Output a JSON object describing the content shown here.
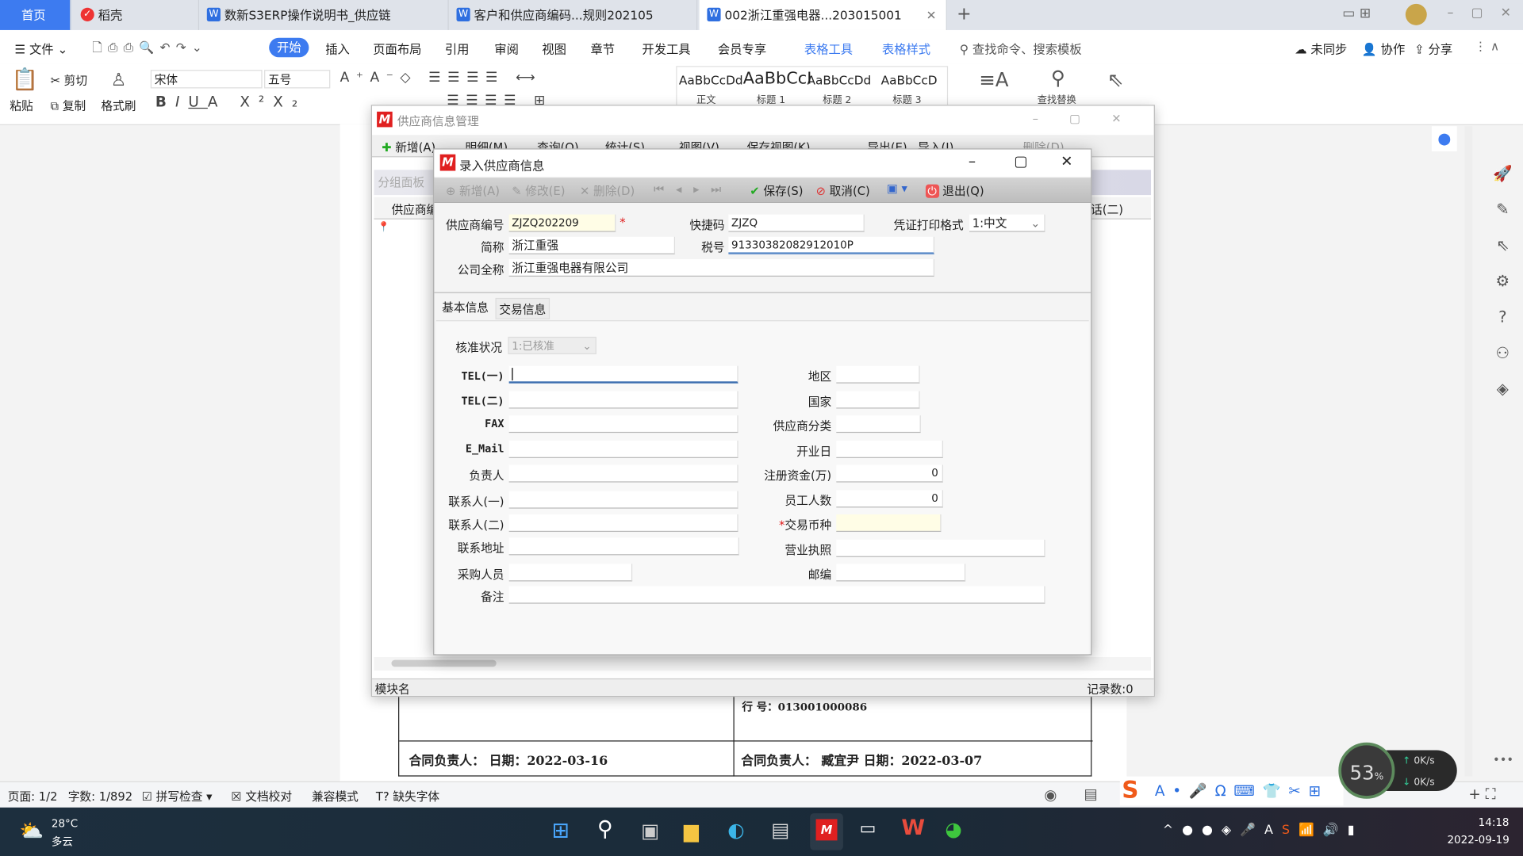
{
  "tabs": [
    {
      "label": "首页"
    },
    {
      "label": "稻壳"
    },
    {
      "label": "数新S3ERP操作说明书_供应链"
    },
    {
      "label": "客户和供应商编码...规则202105"
    },
    {
      "label": "002浙江重强电器...203015001"
    }
  ],
  "menu": {
    "file": "文件",
    "items": [
      "开始",
      "插入",
      "页面布局",
      "引用",
      "审阅",
      "视图",
      "章节",
      "开发工具",
      "会员专享",
      "表格工具",
      "表格样式"
    ],
    "search": "查找命令、搜索模板",
    "sync": "未同步",
    "collab": "协作",
    "share": "分享"
  },
  "ribbon": {
    "paste": "粘贴",
    "cut": "剪切",
    "copy": "复制",
    "format_painter": "格式刷",
    "font": "宋体",
    "size": "五号",
    "styles": [
      {
        "sample": "AaBbCcDd",
        "name": "正文"
      },
      {
        "sample": "AaBbCcI",
        "name": "标题 1"
      },
      {
        "sample": "AaBbCcDd",
        "name": "标题 2"
      },
      {
        "sample": "AaBbCcD",
        "name": "标题 3"
      }
    ],
    "layout": "文字排版",
    "find": "查找替换",
    "select": "选择"
  },
  "document": {
    "cell1": "合同负责人：    日期：2022-03-16",
    "cell2": "合同负责人：  臧宜尹   日期：2022-03-07",
    "partial": "行  号：013001000086"
  },
  "outer_window": {
    "title": "供应商信息管理",
    "toolbar": [
      "新增(A)",
      "明细(M)",
      "查询(Q)",
      "统计(S)",
      "视图(V)",
      "保存视图(K)",
      "导出(E)",
      "导入(I)",
      "删除(D)"
    ],
    "group_panel": "分组面板",
    "col_first": "供应商编",
    "col_last": "话(二)",
    "module": "模块名",
    "records": "记录数:0"
  },
  "dialog": {
    "title": "录入供应商信息",
    "toolbar": {
      "new": "新增(A)",
      "edit": "修改(E)",
      "delete": "删除(D)",
      "save": "保存(S)",
      "cancel": "取消(C)",
      "exit": "退出(Q)"
    },
    "header": {
      "code_label": "供应商编号",
      "code": "ZJZQ202209",
      "quick_label": "快捷码",
      "quick": "ZJZQ",
      "print_label": "凭证打印格式",
      "print": "1:中文",
      "short_label": "简称",
      "short": "浙江重强",
      "tax_label": "税号",
      "tax": "91330382082912010P",
      "full_label": "公司全称",
      "full": "浙江重强电器有限公司"
    },
    "tabs": [
      "基本信息",
      "交易信息"
    ],
    "basic": {
      "approval_label": "核准状况",
      "approval": "1:已核准",
      "left": [
        {
          "label": "TEL(一)",
          "value": ""
        },
        {
          "label": "TEL(二)",
          "value": ""
        },
        {
          "label": "FAX",
          "value": ""
        },
        {
          "label": "E_Mail",
          "value": ""
        },
        {
          "label": "负责人",
          "value": ""
        },
        {
          "label": "联系人(一)",
          "value": ""
        },
        {
          "label": "联系人(二)",
          "value": ""
        },
        {
          "label": "联系地址",
          "value": ""
        },
        {
          "label": "采购人员",
          "value": ""
        }
      ],
      "right": [
        {
          "label": "地区",
          "value": ""
        },
        {
          "label": "国家",
          "value": ""
        },
        {
          "label": "供应商分类",
          "value": ""
        },
        {
          "label": "开业日",
          "value": ""
        },
        {
          "label": "注册资金(万)",
          "value": "0"
        },
        {
          "label": "员工人数",
          "value": "0"
        },
        {
          "label": "交易币种",
          "value": ""
        },
        {
          "label": "营业执照",
          "value": ""
        },
        {
          "label": "邮编",
          "value": ""
        }
      ],
      "remark_label": "备注",
      "remark": ""
    }
  },
  "statusbar": {
    "page": "页面: 1/2",
    "words": "字数: 1/892",
    "spell": "拼写检查",
    "proof": "文档校对",
    "compat": "兼容模式",
    "missing_font": "缺失字体"
  },
  "net": {
    "percent": "53",
    "unit": "%",
    "up": "0K/s",
    "down": "0K/s"
  },
  "taskbar": {
    "temp": "28°C",
    "weather": "多云",
    "time": "14:18",
    "date": "2022-09-19"
  },
  "colors": {
    "accent": "#3d7bf0",
    "required": "#e02020",
    "required_bg": "#fffde6"
  }
}
